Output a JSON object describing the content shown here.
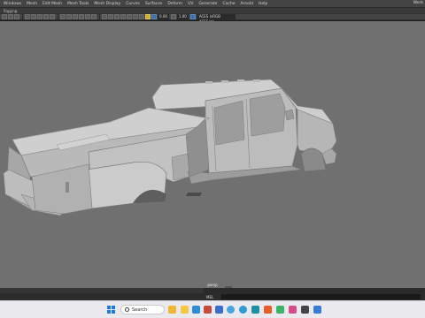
{
  "menu": {
    "items": [
      "Windows",
      "Mesh",
      "Edit Mesh",
      "Mesh Tools",
      "Mesh Display",
      "Curves",
      "Surfaces",
      "Deform",
      "UV",
      "Generate",
      "Cache",
      "Arnold",
      "Help"
    ],
    "right_label": "Work"
  },
  "subbar": {
    "label": "Rigging"
  },
  "toolbar": {
    "field1": "0.00",
    "field2": "1.00",
    "color_management": "ACES (sRGB ACEScg)"
  },
  "viewport": {
    "camera_label": "persp"
  },
  "cmdline": {
    "label": "MEL"
  },
  "taskbar": {
    "search_placeholder": "Search",
    "apps": [
      "weather-icon",
      "file-explorer-icon",
      "edge-icon",
      "store-icon",
      "photos-icon",
      "chrome-icon",
      "firefox-icon",
      "maya-icon",
      "settings-icon",
      "instagram-icon",
      "paint-icon",
      "terminal-icon",
      "mail-icon"
    ]
  },
  "colors": {
    "viewport_bg": "#707070",
    "model_light": "#c8c8c8",
    "model_mid": "#a9a9a9",
    "model_dark": "#7e7e7e",
    "accent_blue": "#1f7ae0"
  }
}
